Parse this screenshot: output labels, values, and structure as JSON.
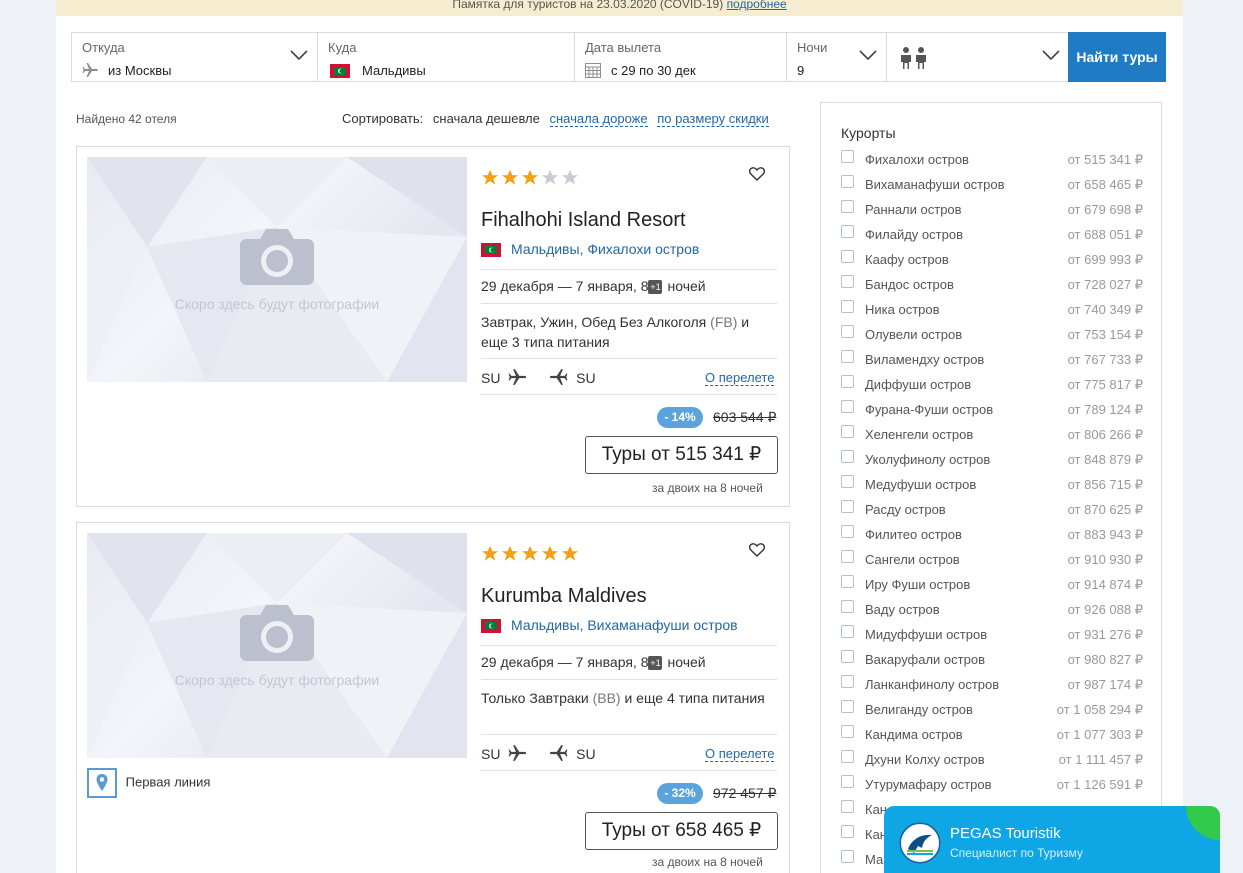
{
  "notice": {
    "text": "Памятка для туристов на 23.03.2020 (COVID-19)",
    "link": "подробнее"
  },
  "search": {
    "from": {
      "label": "Откуда",
      "value": "из Москвы"
    },
    "to": {
      "label": "Куда",
      "value": "Мальдивы"
    },
    "date": {
      "label": "Дата вылета",
      "value": "с 29 по 30 дек"
    },
    "nights": {
      "label": "Ночи",
      "value": "9"
    },
    "button": "Найти туры"
  },
  "results": {
    "found": "Найдено 42 отеля",
    "sort_label": "Сортировать:",
    "sort_active": "сначала дешевле",
    "sort_options": [
      "сначала дороже",
      "по размеру скидки"
    ]
  },
  "hotels": [
    {
      "stars": 3,
      "name": "Fihalhohi Island Resort",
      "country": "Мальдивы",
      "resort": "Фихалохи остров",
      "photo_caption": "Скоро здесь будут фотографии",
      "dates": "29 декабря — 7 января, 8",
      "plus": "+1",
      "nights_word": "ночей",
      "meal": "Завтрак, Ужин, Обед Без Алкоголя",
      "meal_code": "(FB)",
      "meal_more": "и еще 3 типа питания",
      "airline_out": "SU",
      "airline_back": "SU",
      "flight_link": "О перелете",
      "discount": "- 14%",
      "old_price": "603 544 ₽",
      "price": "Туры от 515 341 ₽",
      "for_two": "за двоих на 8 ночей"
    },
    {
      "stars": 5,
      "name": "Kurumba Maldives",
      "country": "Мальдивы",
      "resort": "Вихаманафуши остров",
      "photo_caption": "Скоро здесь будут фотографии",
      "dates": "29 декабря — 7 января, 8",
      "plus": "+1",
      "nights_word": "ночей",
      "meal": "Только Завтраки",
      "meal_code": "(BB)",
      "meal_more": "и еще 4 типа питания",
      "airline_out": "SU",
      "airline_back": "SU",
      "flight_link": "О перелете",
      "discount": "- 32%",
      "old_price": "972 457 ₽",
      "price": "Туры от 658 465 ₽",
      "for_two": "за двоих на 8 ночей",
      "first_line": "Первая линия"
    }
  ],
  "sidebar": {
    "title": "Курорты",
    "resorts": [
      {
        "name": "Фихалохи остров",
        "price": "от 515 341 ₽"
      },
      {
        "name": "Вихаманафуши остров",
        "price": "от 658 465 ₽"
      },
      {
        "name": "Раннали остров",
        "price": "от 679 698 ₽"
      },
      {
        "name": "Филайду остров",
        "price": "от 688 051 ₽"
      },
      {
        "name": "Каафу остров",
        "price": "от 699 993 ₽"
      },
      {
        "name": "Бандос остров",
        "price": "от 728 027 ₽"
      },
      {
        "name": "Ника остров",
        "price": "от 740 349 ₽"
      },
      {
        "name": "Олувели остров",
        "price": "от 753 154 ₽"
      },
      {
        "name": "Виламендху остров",
        "price": "от 767 733 ₽"
      },
      {
        "name": "Диффуши остров",
        "price": "от 775 817 ₽"
      },
      {
        "name": "Фурана-Фуши остров",
        "price": "от 789 124 ₽"
      },
      {
        "name": "Хеленгели остров",
        "price": "от 806 266 ₽"
      },
      {
        "name": "Уколуфинолу остров",
        "price": "от 848 879 ₽"
      },
      {
        "name": "Медуфуши остров",
        "price": "от 856 715 ₽"
      },
      {
        "name": "Расду остров",
        "price": "от 870 625 ₽"
      },
      {
        "name": "Филитео остров",
        "price": "от 883 943 ₽"
      },
      {
        "name": "Сангели остров",
        "price": "от 910 930 ₽"
      },
      {
        "name": "Иру Фуши остров",
        "price": "от 914 874 ₽"
      },
      {
        "name": "Ваду остров",
        "price": "от 926 088 ₽"
      },
      {
        "name": "Мидуффуши остров",
        "price": "от 931 276 ₽"
      },
      {
        "name": "Вакаруфали остров",
        "price": "от 980 827 ₽"
      },
      {
        "name": "Ланканфинолу остров",
        "price": "от 987 174 ₽"
      },
      {
        "name": "Велигандy остров",
        "price": "от 1 058 294 ₽"
      },
      {
        "name": "Кандима остров",
        "price": "от 1 077 303 ₽"
      },
      {
        "name": "Дхуни Колху остров",
        "price": "от 1 111 457 ₽"
      },
      {
        "name": "Утурумафару остров",
        "price": "от 1 126 591 ₽"
      },
      {
        "name": "Кан",
        "price": ""
      },
      {
        "name": "Кан",
        "price": ""
      },
      {
        "name": "Ма",
        "price": ""
      }
    ]
  },
  "chat": {
    "title": "PEGAS Touristik",
    "subtitle": "Специалист по Туризму"
  },
  "colors": {
    "accent": "#1f7bc4",
    "star": "#f4a012",
    "link": "#2267a8",
    "chat": "#0fa6e6"
  }
}
